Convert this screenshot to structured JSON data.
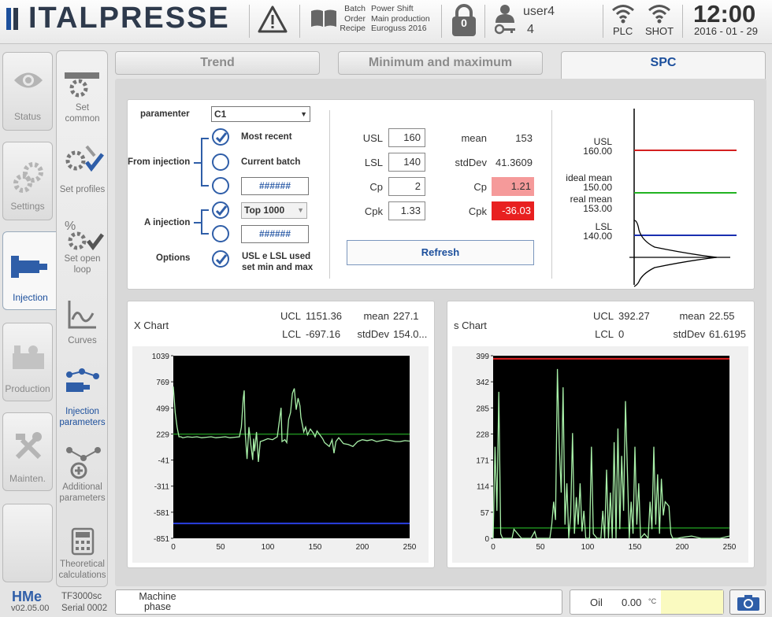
{
  "header": {
    "brand": "ITALPRESSE",
    "batch_labels": [
      "Batch",
      "Order",
      "Recipe"
    ],
    "batch_values": [
      "Power Shift",
      "Main production",
      "Euroguss 2016"
    ],
    "lock_count": "0",
    "user": "user4",
    "user_level": "4",
    "plc_label": "PLC",
    "shot_label": "SHOT",
    "time": "12:00",
    "date": "2016 - 01 - 29"
  },
  "sidebar": {
    "main": [
      "Status",
      "Settings",
      "Injection",
      "Production",
      "Mainten."
    ],
    "sub": [
      "Set\ncommon",
      "Set profiles",
      "Set open\nloop",
      "Curves",
      "Injection\nparameters",
      "Additional\nparameters",
      "Theoretical\ncalculations"
    ]
  },
  "tabs": [
    "Trend",
    "Minimum and maximum",
    "SPC"
  ],
  "spc": {
    "parameter_label": "paramenter",
    "parameter_value": "C1",
    "from_injection_label": "From injection",
    "opt_most_recent": "Most recent",
    "opt_current_batch": "Current batch",
    "hash_placeholder": "######",
    "a_injection_label": "A injection",
    "top_select": "Top 1000",
    "options_label": "Options",
    "options_text": "USL e LSL used\nset min and max",
    "usl_label": "USL",
    "usl_value": "160",
    "lsl_label": "LSL",
    "lsl_value": "140",
    "cp_label": "Cp",
    "cp_value": "2",
    "cpk_label": "Cpk",
    "cpk_value": "1.33",
    "mean_label": "mean",
    "mean_value": "153",
    "stddev_label": "stdDev",
    "stddev_value": "41.3609",
    "cp_calc_label": "Cp",
    "cp_calc_value": "1.21",
    "cpk_calc_label": "Cpk",
    "cpk_calc_value": "-36.03",
    "refresh_label": "Refresh",
    "dist_usl": "USL\n160.00",
    "dist_ideal": "ideal mean\n150.00",
    "dist_real": "real mean\n153.00",
    "dist_lsl": "LSL\n140.00",
    "colors": {
      "usl": "#d42020",
      "mean": "#22b322",
      "lsl": "#1a2fb0",
      "cp_bg": "#f59a9a",
      "cpk_bg": "#e82020"
    }
  },
  "xchart": {
    "title": "X Chart",
    "ucl_label": "UCL",
    "ucl_value": "1151.36",
    "lcl_label": "LCL",
    "lcl_value": "-697.16",
    "mean_label": "mean",
    "mean_value": "227.1",
    "stddev_label": "stdDev",
    "stddev_value": "154.0..."
  },
  "schart": {
    "title": "s Chart",
    "ucl_label": "UCL",
    "ucl_value": "392.27",
    "lcl_label": "LCL",
    "lcl_value": "0",
    "mean_label": "mean",
    "mean_value": "22.55",
    "stddev_label": "stdDev",
    "stddev_value": "61.6195"
  },
  "chart_data": [
    {
      "type": "line",
      "title": "X Chart",
      "xlim": [
        0,
        250
      ],
      "ylim": [
        -851,
        1039
      ],
      "xticks": [
        0,
        50,
        100,
        150,
        200,
        250
      ],
      "yticks": [
        1039,
        769,
        499,
        229,
        -41,
        -311,
        -581,
        -851
      ],
      "ucl": 1151.36,
      "lcl": -697.16,
      "mean": 227.1,
      "series": [
        {
          "x": [
            0,
            2,
            4,
            6,
            8,
            10,
            15,
            20,
            25,
            30,
            35,
            40,
            45,
            50,
            55,
            60,
            65,
            70,
            72,
            74,
            75,
            76,
            78,
            80,
            82,
            84,
            85,
            86,
            88,
            90,
            92,
            95,
            100,
            105,
            110,
            112,
            114,
            115,
            118,
            120,
            122,
            124,
            126,
            128,
            130,
            132,
            134,
            135,
            138,
            140,
            142,
            145,
            148,
            150,
            152,
            155,
            158,
            160,
            165,
            168,
            170,
            172,
            175,
            180,
            185,
            190,
            195,
            200,
            205,
            210,
            215,
            220,
            225,
            230,
            235,
            240,
            245,
            250
          ],
          "y": [
            720,
            450,
            300,
            200,
            200,
            190,
            200,
            195,
            200,
            190,
            195,
            200,
            190,
            195,
            200,
            190,
            195,
            200,
            300,
            600,
            680,
            250,
            -30,
            300,
            120,
            -40,
            180,
            50,
            250,
            -60,
            150,
            160,
            180,
            170,
            200,
            350,
            500,
            150,
            170,
            140,
            380,
            450,
            650,
            700,
            480,
            600,
            520,
            400,
            250,
            300,
            220,
            280,
            240,
            200,
            260,
            220,
            180,
            140,
            100,
            170,
            30,
            150,
            190,
            130,
            120,
            100,
            150,
            170,
            160,
            170,
            150,
            160,
            170,
            160,
            150,
            150,
            160,
            155
          ]
        }
      ]
    },
    {
      "type": "line",
      "title": "s Chart",
      "xlim": [
        0,
        250
      ],
      "ylim": [
        0,
        399
      ],
      "xticks": [
        0,
        50,
        100,
        150,
        200,
        250
      ],
      "yticks": [
        399,
        342,
        285,
        228,
        171,
        114,
        57,
        0
      ],
      "ucl": 392.27,
      "lcl": 0,
      "mean": 22.55,
      "series": [
        {
          "x": [
            0,
            2,
            4,
            6,
            8,
            10,
            20,
            22,
            30,
            40,
            44,
            46,
            50,
            60,
            62,
            64,
            66,
            68,
            70,
            72,
            74,
            76,
            78,
            80,
            82,
            84,
            86,
            88,
            90,
            92,
            94,
            96,
            98,
            100,
            102,
            104,
            106,
            110,
            114,
            116,
            118,
            120,
            122,
            124,
            126,
            128,
            130,
            132,
            134,
            136,
            138,
            140,
            144,
            146,
            148,
            150,
            152,
            154,
            156,
            160,
            164,
            166,
            168,
            170,
            172,
            174,
            176,
            178,
            180,
            182,
            186,
            188,
            190,
            195,
            200,
            210,
            220,
            230,
            240,
            250
          ],
          "y": [
            0,
            200,
            60,
            320,
            10,
            0,
            0,
            20,
            0,
            0,
            15,
            0,
            0,
            0,
            30,
            80,
            40,
            370,
            200,
            100,
            330,
            30,
            120,
            0,
            50,
            230,
            10,
            90,
            30,
            120,
            15,
            60,
            0,
            0,
            0,
            200,
            10,
            0,
            0,
            60,
            0,
            150,
            0,
            100,
            0,
            210,
            0,
            240,
            20,
            180,
            60,
            300,
            0,
            80,
            10,
            200,
            30,
            120,
            0,
            10,
            0,
            80,
            20,
            200,
            30,
            140,
            10,
            130,
            50,
            80,
            70,
            10,
            0,
            0,
            2,
            5,
            0,
            0,
            0,
            5
          ]
        }
      ]
    }
  ],
  "bottom": {
    "version_logo": "HMe",
    "version": "v02.05.00",
    "model": "TF3000sc",
    "serial": "Serial 0002",
    "machine_phase": "Machine\nphase",
    "oil_label": "Oil",
    "oil_value": "0.00",
    "oil_unit": "°C"
  }
}
